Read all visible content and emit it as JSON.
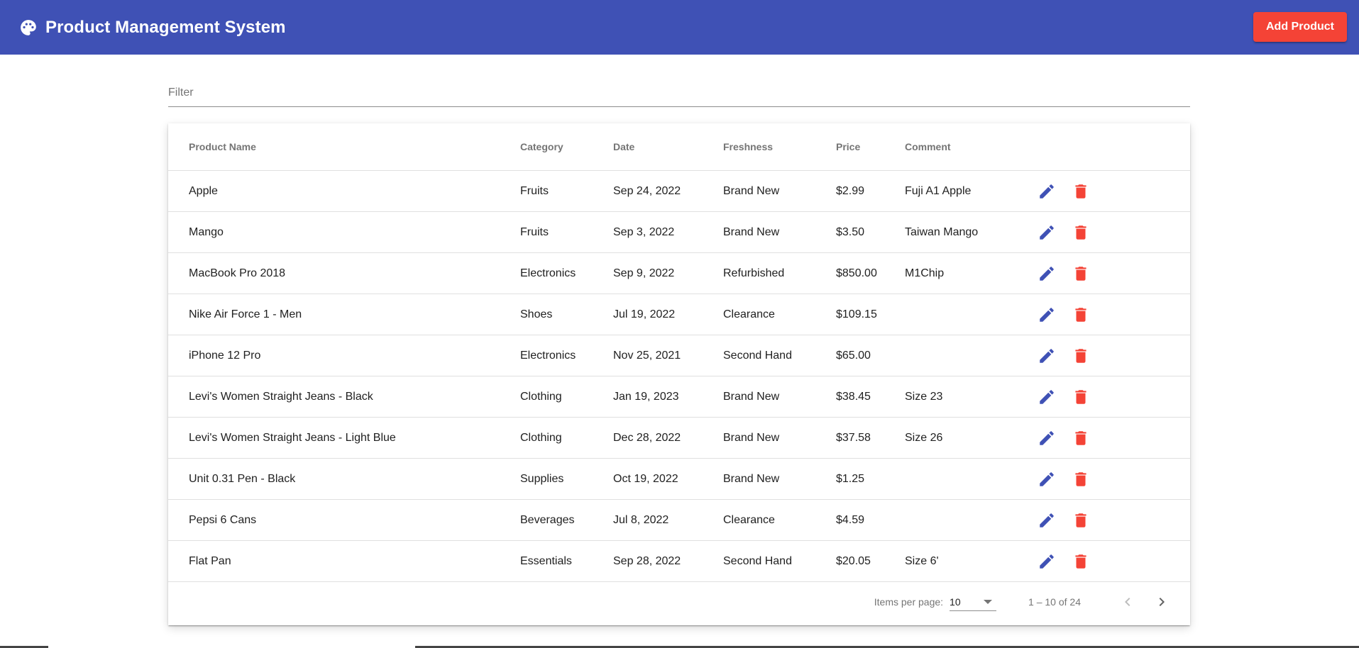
{
  "header": {
    "title": "Product Management System",
    "logo_icon": "palette-icon",
    "add_button_label": "Add Product"
  },
  "filter": {
    "placeholder": "Filter",
    "value": ""
  },
  "table": {
    "columns": [
      "Product Name",
      "Category",
      "Date",
      "Freshness",
      "Price",
      "Comment",
      ""
    ],
    "rows": [
      {
        "name": "Apple",
        "category": "Fruits",
        "date": "Sep 24, 2022",
        "freshness": "Brand New",
        "price": "$2.99",
        "comment": "Fuji A1 Apple"
      },
      {
        "name": "Mango",
        "category": "Fruits",
        "date": "Sep 3, 2022",
        "freshness": "Brand New",
        "price": "$3.50",
        "comment": "Taiwan Mango"
      },
      {
        "name": "MacBook Pro 2018",
        "category": "Electronics",
        "date": "Sep 9, 2022",
        "freshness": "Refurbished",
        "price": "$850.00",
        "comment": "M1Chip"
      },
      {
        "name": "Nike Air Force 1 - Men",
        "category": "Shoes",
        "date": "Jul 19, 2022",
        "freshness": "Clearance",
        "price": "$109.15",
        "comment": ""
      },
      {
        "name": "iPhone 12 Pro",
        "category": "Electronics",
        "date": "Nov 25, 2021",
        "freshness": "Second Hand",
        "price": "$65.00",
        "comment": ""
      },
      {
        "name": "Levi's Women Straight Jeans - Black",
        "category": "Clothing",
        "date": "Jan 19, 2023",
        "freshness": "Brand New",
        "price": "$38.45",
        "comment": "Size 23"
      },
      {
        "name": "Levi's Women Straight Jeans - Light Blue",
        "category": "Clothing",
        "date": "Dec 28, 2022",
        "freshness": "Brand New",
        "price": "$37.58",
        "comment": "Size 26"
      },
      {
        "name": "Unit 0.31 Pen - Black",
        "category": "Supplies",
        "date": "Oct 19, 2022",
        "freshness": "Brand New",
        "price": "$1.25",
        "comment": ""
      },
      {
        "name": "Pepsi 6 Cans",
        "category": "Beverages",
        "date": "Jul 8, 2022",
        "freshness": "Clearance",
        "price": "$4.59",
        "comment": ""
      },
      {
        "name": "Flat Pan",
        "category": "Essentials",
        "date": "Sep 28, 2022",
        "freshness": "Second Hand",
        "price": "$20.05",
        "comment": "Size 6'"
      }
    ],
    "row_actions": [
      "edit-icon",
      "delete-icon"
    ]
  },
  "paginator": {
    "items_per_page_label": "Items per page:",
    "items_per_page_value": "10",
    "range_label": "1 – 10 of 24"
  },
  "colors": {
    "primary": "#3f51b5",
    "warn": "#f44336"
  }
}
